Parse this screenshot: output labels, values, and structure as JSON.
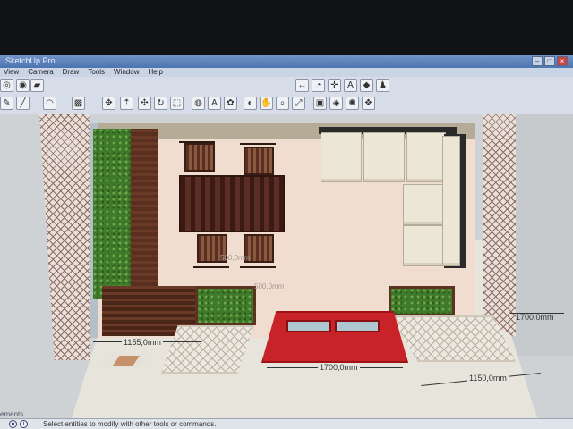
{
  "window": {
    "title": "SketchUp Pro",
    "controls": [
      "–",
      "□",
      "×"
    ]
  },
  "menu": [
    "View",
    "Camera",
    "Draw",
    "Tools",
    "Window",
    "Help"
  ],
  "toolbar_icons": [
    "orbit-icon",
    "paint-bucket-icon",
    "eraser-icon",
    "pencil-icon",
    "arc-icon",
    "rectangle-icon",
    "move-icon",
    "push-pull-icon",
    "rotate-icon",
    "follow-me-icon",
    "scale-icon",
    "offset-icon",
    "tape-measure-icon",
    "text-icon",
    "paint-icon",
    "orbit-view-icon",
    "pan-icon",
    "zoom-icon",
    "zoom-extents-icon",
    "components-icon",
    "materials-icon",
    "styles-icon",
    "layers-icon",
    "dimension-icon",
    "protractor-icon",
    "axes-icon",
    "3d-text-icon",
    "section-plane-icon",
    "walk-icon"
  ],
  "dimensions": {
    "left_bottom": "1155,0mm",
    "center_bottom": "1700,0mm",
    "right_bottom": "1150,0mm",
    "right_side": "1700,0mm",
    "ghost_1": "500,0mm",
    "ghost_2": "500,0mm"
  },
  "status": {
    "left_label": "ements",
    "hint": "Select entities to modify with other tools or commands."
  }
}
